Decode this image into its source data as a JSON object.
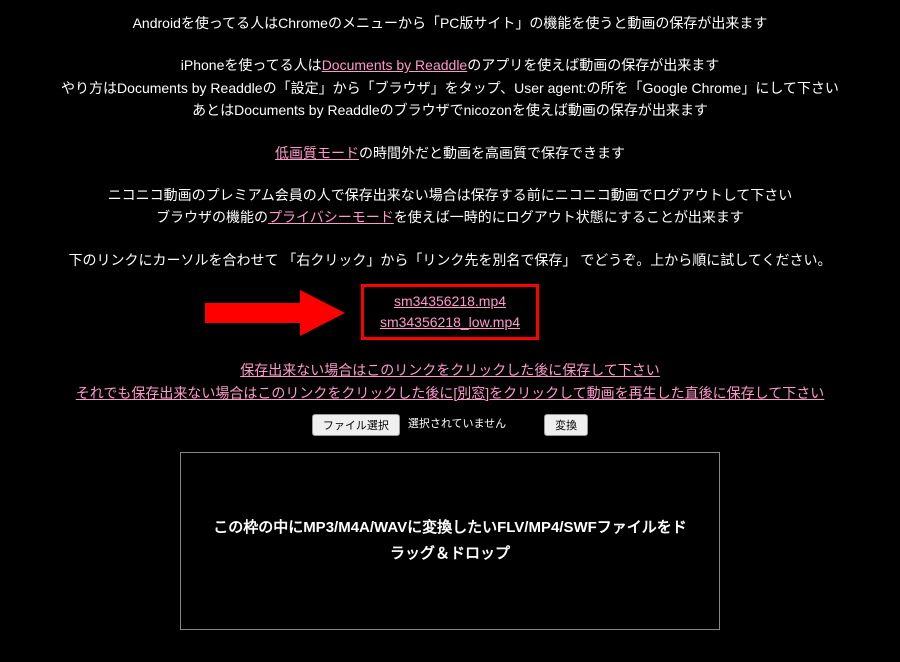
{
  "intro": {
    "android": "Androidを使ってる人はChromeのメニューから「PC版サイト」の機能を使うと動画の保存が出来ます",
    "iphone_before": "iPhoneを使ってる人は",
    "iphone_link": "Documents by Readdle",
    "iphone_after": "のアプリを使えば動画の保存が出来ます",
    "readdle_howto": "やり方はDocuments by Readdleの「設定」から「ブラウザ」をタップ、User agent:の所を「Google Chrome」にして下さい",
    "readdle_then": "あとはDocuments by Readdleのブラウザでnicozonを使えば動画の保存が出来ます"
  },
  "quality": {
    "link": "低画質モード",
    "after": "の時間外だと動画を高画質で保存できます"
  },
  "premium": {
    "line1": "ニコニコ動画のプレミアム会員の人で保存出来ない場合は保存する前にニコニコ動画でログアウトして下さい",
    "line2_before": "ブラウザの機能の",
    "line2_link": "プライバシーモード",
    "line2_after": "を使えば一時的にログアウト状態にすることが出来ます"
  },
  "instruction": "下のリンクにカーソルを合わせて 「右クリック」から「リンク先を別名で保存」 でどうぞ。上から順に試してください。",
  "downloads": {
    "file1": "sm34356218.mp4",
    "file2": "sm34356218_low.mp4"
  },
  "fallback": {
    "link1": "保存出来ない場合はこのリンクをクリックした後に保存して下さい",
    "link2": "それでも保存出来ない場合はこのリンクをクリックした後に[別窓]をクリックして動画を再生した直後に保存して下さい"
  },
  "filerow": {
    "choose": "ファイル選択",
    "status": "選択されていません",
    "convert": "変換"
  },
  "dropzone": "この枠の中にMP3/M4A/WAVに変換したいFLV/MP4/SWFファイルをドラッグ＆ドロップ"
}
